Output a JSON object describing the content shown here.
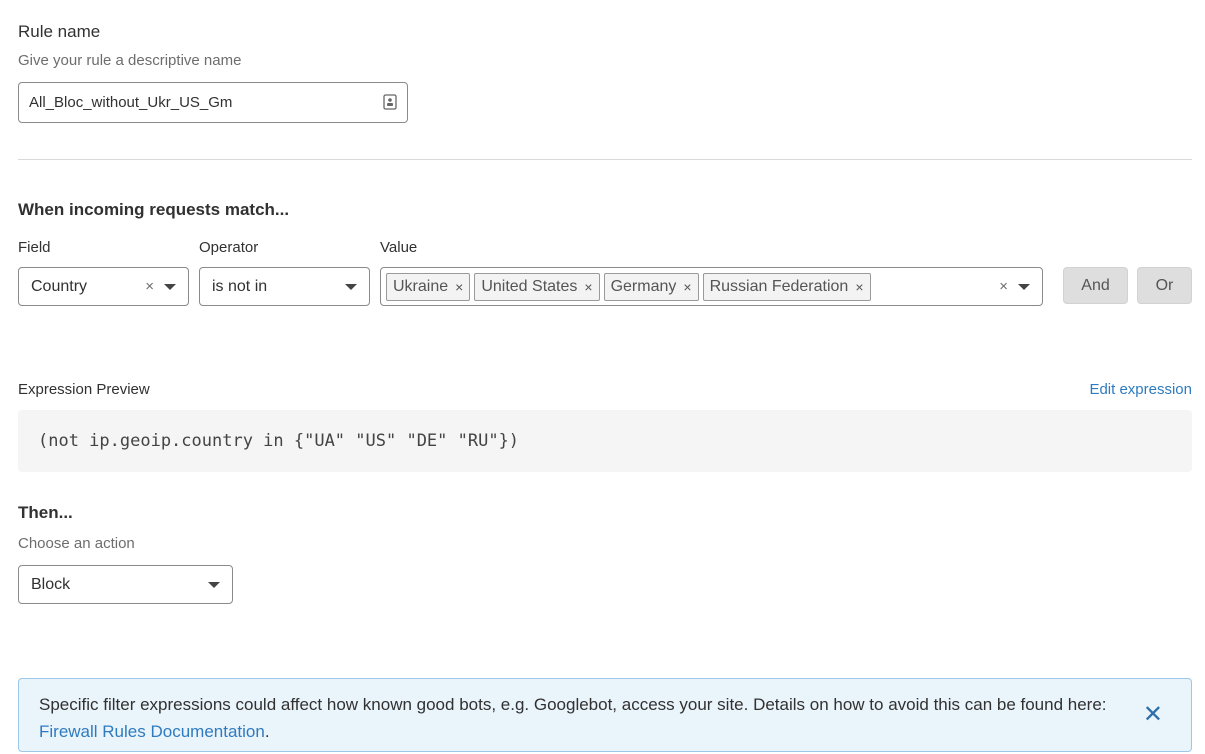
{
  "rule_name": {
    "label": "Rule name",
    "hint": "Give your rule a descriptive name",
    "value": "All_Bloc_without_Ukr_US_Gm"
  },
  "match": {
    "title": "When incoming requests match...",
    "field_label": "Field",
    "operator_label": "Operator",
    "value_label": "Value",
    "field_value": "Country",
    "operator_value": "is not in",
    "tags": [
      "Ukraine",
      "United States",
      "Germany",
      "Russian Federation"
    ],
    "and_label": "And",
    "or_label": "Or"
  },
  "expression": {
    "label": "Expression Preview",
    "edit_link": "Edit expression",
    "code": "(not ip.geoip.country in {\"UA\" \"US\" \"DE\" \"RU\"})"
  },
  "action": {
    "title": "Then...",
    "hint": "Choose an action",
    "value": "Block"
  },
  "notice": {
    "text": "Specific filter expressions could affect how known good bots, e.g. Googlebot, access your site. Details on how to avoid this can be found here: ",
    "link": "Firewall Rules Documentation",
    "end": "."
  },
  "icons": {
    "clear": "×",
    "close": "✕"
  }
}
